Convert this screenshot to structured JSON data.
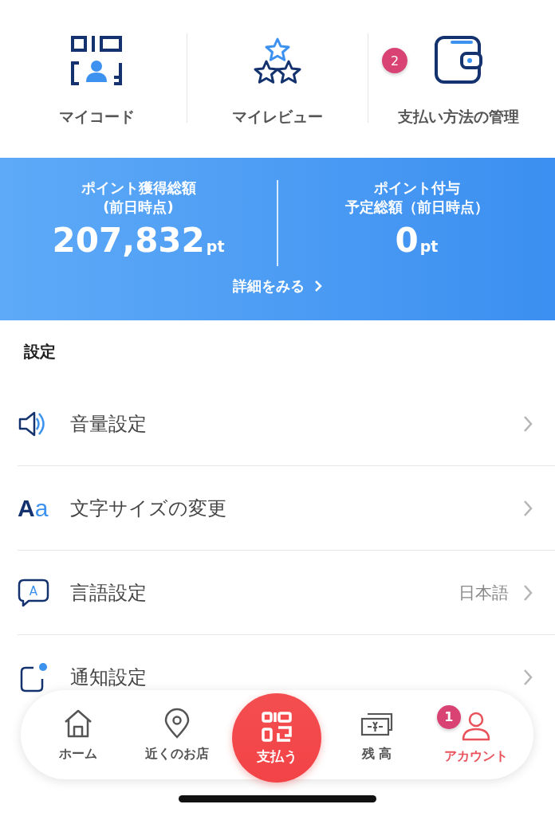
{
  "shortcuts": [
    {
      "kind": "code",
      "label": "マイコード"
    },
    {
      "kind": "review",
      "label": "マイレビュー"
    },
    {
      "kind": "wallet",
      "label": "支払い方法の管理",
      "badge": "2"
    }
  ],
  "points": {
    "earned": {
      "title": "ポイント獲得総額",
      "subtitle": "(前日時点)",
      "value": "207,832",
      "unit": "pt"
    },
    "scheduled": {
      "title": "ポイント付与",
      "subtitle": "予定総額（前日時点）",
      "value": "0",
      "unit": "pt"
    },
    "details_link": "詳細をみる"
  },
  "settings": {
    "heading": "設定",
    "items": [
      {
        "kind": "volume",
        "label": "音量設定"
      },
      {
        "kind": "text",
        "label": "文字サイズの変更",
        "icon_text": "Aa"
      },
      {
        "kind": "language",
        "label": "言語設定",
        "icon_text": "A",
        "value": "日本語"
      },
      {
        "kind": "notify",
        "label": "通知設定"
      }
    ]
  },
  "tab_bar": [
    {
      "kind": "home",
      "label": "ホーム",
      "selected": false
    },
    {
      "kind": "map",
      "label": "近くのお店",
      "selected": false
    },
    {
      "kind": "pay",
      "label": "支払う",
      "selected": false
    },
    {
      "kind": "balance",
      "label": "残 高",
      "selected": false
    },
    {
      "kind": "account",
      "label": "アカウント",
      "selected": true,
      "badge": "1"
    }
  ]
}
